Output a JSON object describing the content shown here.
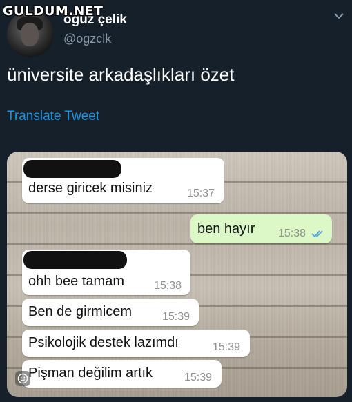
{
  "watermark": {
    "text": "GULDUM.NET"
  },
  "author": {
    "display_name": "oğuz çelik",
    "handle": "@ogzclk"
  },
  "tweet": {
    "text": "üniversite arkadaşlıkları özet",
    "translate_label": "Translate Tweet"
  },
  "chat": {
    "messages": [
      {
        "direction": "in",
        "text": "derse giricek misiniz",
        "time": "15:37"
      },
      {
        "direction": "out",
        "text": "ben hayır",
        "time": "15:38",
        "read": true
      },
      {
        "direction": "in",
        "text": "ohh bee tamam",
        "time": "15:38"
      },
      {
        "direction": "in",
        "text": "Ben de girmicem",
        "time": "15:39"
      },
      {
        "direction": "in",
        "text": "Psikolojik destek lazımdı",
        "time": "15:39"
      },
      {
        "direction": "in",
        "text": "Pişman değilim artık",
        "time": "15:39"
      }
    ]
  },
  "colors": {
    "background": "#15202b",
    "link": "#1b95e0",
    "outgoing_bubble": "#dcf8c6",
    "read_ticks": "#4fa3e0"
  },
  "icons": {
    "menu": "chevron-down-icon",
    "ticks": "double-check-icon",
    "emoji": "emoji-icon"
  }
}
